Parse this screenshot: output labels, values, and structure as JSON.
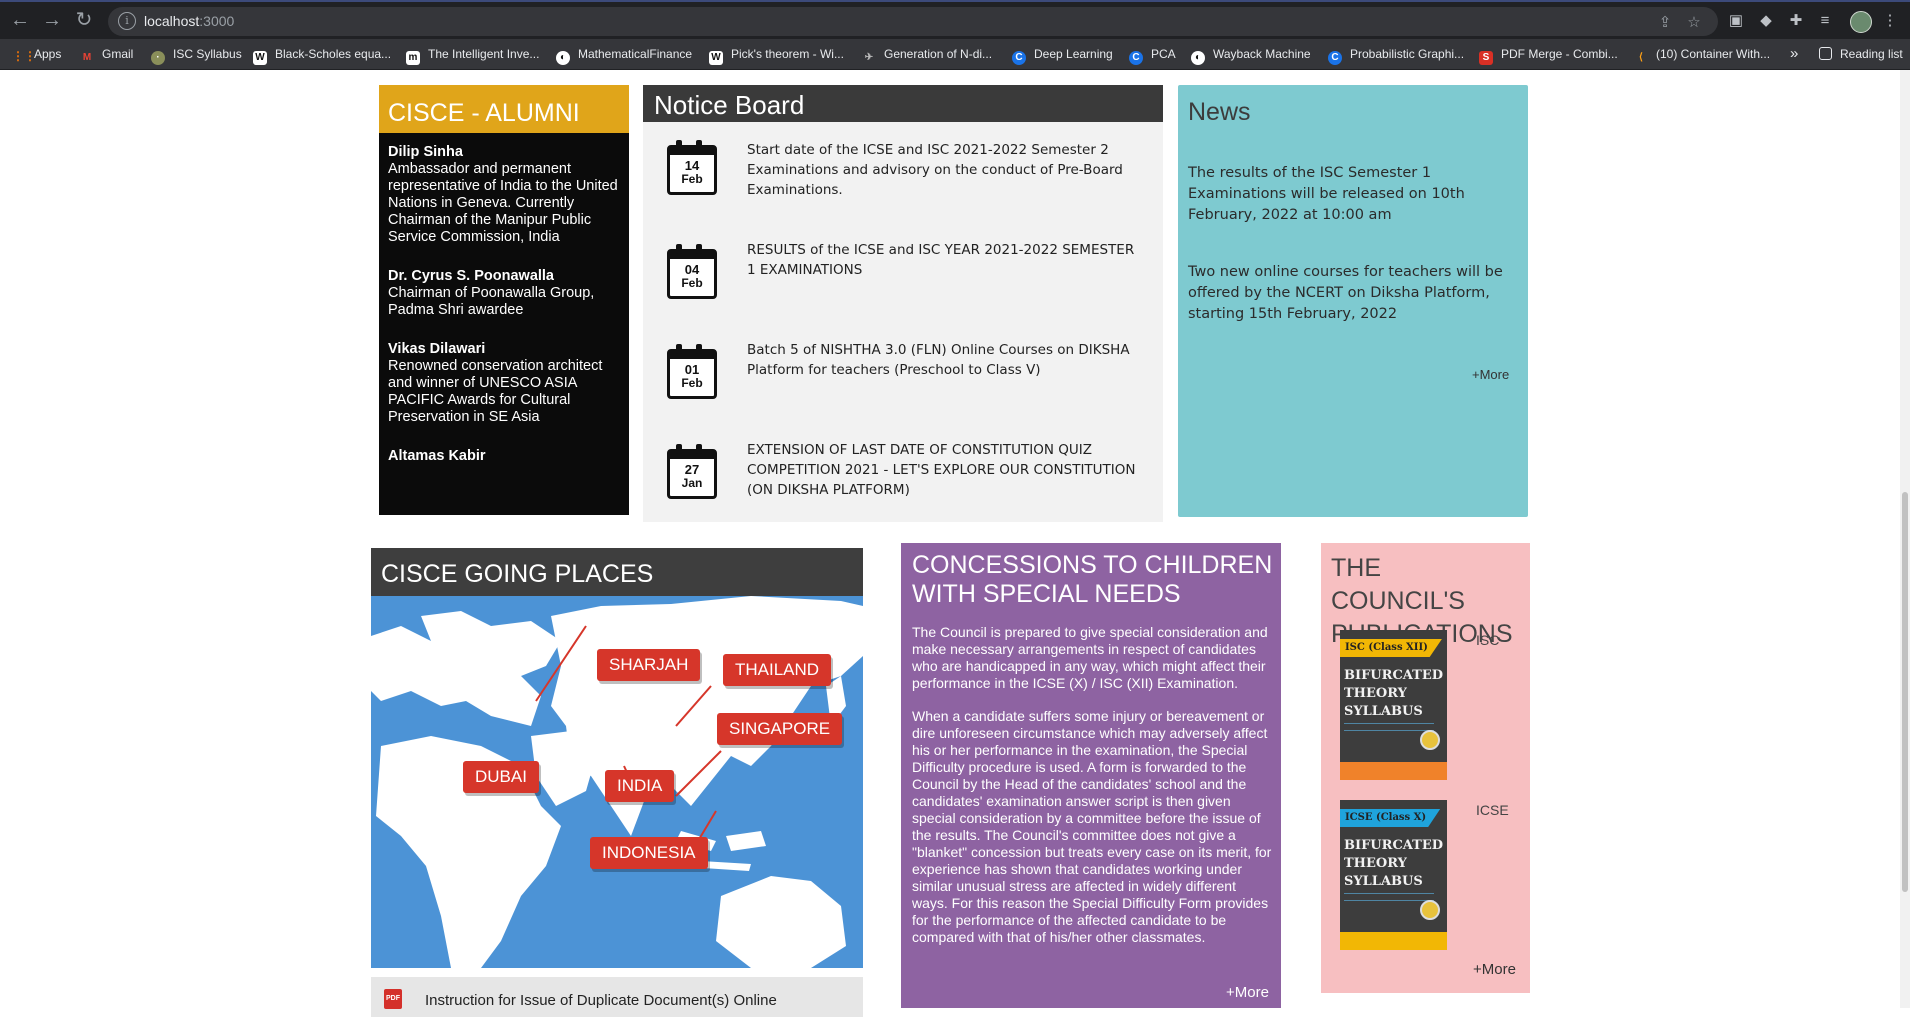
{
  "browser": {
    "url_host": "localhost",
    "url_port": ":3000",
    "bookmarks": [
      {
        "label": "Apps",
        "icon": "apps-grid-icon",
        "color": "#e8710a"
      },
      {
        "label": "Gmail",
        "icon": "gmail-icon",
        "color": "#d93025"
      },
      {
        "label": "ISC Syllabus",
        "icon": "isc-icon",
        "color": "#8a8f5a"
      },
      {
        "label": "Black-Scholes equa...",
        "icon": "wikipedia-icon",
        "color": "#ffffff"
      },
      {
        "label": "The Intelligent Inve...",
        "icon": "m-icon",
        "color": "#ffffff"
      },
      {
        "label": "MathematicalFinance",
        "icon": "globe-icon",
        "color": "#ffffff"
      },
      {
        "label": "Pick's theorem - Wi...",
        "icon": "wikipedia-icon",
        "color": "#ffffff"
      },
      {
        "label": "Generation of N-di...",
        "icon": "bird-icon",
        "color": "#444444"
      },
      {
        "label": "Deep Learning",
        "icon": "c-icon",
        "color": "#1a73e8"
      },
      {
        "label": "PCA",
        "icon": "c-icon",
        "color": "#1a73e8"
      },
      {
        "label": "Wayback Machine",
        "icon": "globe-icon",
        "color": "#ffffff"
      },
      {
        "label": "Probabilistic Graphi...",
        "icon": "c-icon",
        "color": "#1a73e8"
      },
      {
        "label": "PDF Merge - Combi...",
        "icon": "s-icon",
        "color": "#d93025"
      },
      {
        "label": "(10) Container With...",
        "icon": "leetcode-icon",
        "color": "#ffa116"
      }
    ],
    "overflow_label": "»",
    "reading_list_label": "Reading list"
  },
  "alumni": {
    "title": "CISCE - ALUMNI",
    "items": [
      {
        "name": "Dilip Sinha",
        "desc": "Ambassador and permanent representative of India to the United Nations in Geneva. Currently Chairman of the Manipur Public Service Commission, India"
      },
      {
        "name": "Dr. Cyrus S. Poonawalla",
        "desc": "Chairman of Poonawalla Group, Padma Shri awardee"
      },
      {
        "name": "Vikas Dilawari",
        "desc": "Renowned conservation architect and winner of UNESCO ASIA PACIFIC Awards for Cultural Preservation in SE Asia"
      },
      {
        "name": "Altamas Kabir",
        "desc": ""
      }
    ]
  },
  "notice": {
    "title": "Notice Board",
    "items": [
      {
        "day": "14",
        "month": "Feb",
        "text": "Start date of the ICSE and ISC 2021-2022 Semester 2 Examinations and advisory on the conduct of Pre-Board Examinations."
      },
      {
        "day": "04",
        "month": "Feb",
        "text": "RESULTS of the ICSE and ISC YEAR 2021-2022 SEMESTER 1 EXAMINATIONS"
      },
      {
        "day": "01",
        "month": "Feb",
        "text": "Batch 5 of NISHTHA 3.0 (FLN) Online Courses on DIKSHA Platform for teachers (Preschool to Class V)"
      },
      {
        "day": "27",
        "month": "Jan",
        "text": "EXTENSION OF LAST DATE OF CONSTITUTION QUIZ COMPETITION 2021 - LET'S EXPLORE OUR CONSTITUTION (ON DIKSHA PLATFORM)"
      }
    ]
  },
  "news": {
    "title": "News",
    "items": [
      "The results of the ISC Semester 1 Examinations will be released on 10th February, 2022 at 10:00 am",
      "Two new online courses for teachers will be offered by the NCERT on Diksha Platform, starting 15th February, 2022"
    ],
    "more": "+More"
  },
  "places": {
    "title": "CISCE GOING PLACES",
    "cities": [
      "SHARJAH",
      "THAILAND",
      "SINGAPORE",
      "DUBAI",
      "INDIA",
      "INDONESIA"
    ]
  },
  "duplicate_doc": {
    "text": "Instruction for Issue of Duplicate Document(s) Online",
    "icon_label": "PDF"
  },
  "concessions": {
    "title": "CONCESSIONS TO CHILDREN WITH SPECIAL NEEDS",
    "paragraphs": [
      "The Council is prepared to give special consideration and make necessary arrangements in respect of candidates who are handicapped in any way, which might affect their performance in the ICSE (X) / ISC (XII) Examination.",
      "When a candidate suffers some injury or bereavement or dire unforeseen circumstance which may adversely affect his or her performance in the examination, the Special Difficulty procedure is used. A form is forwarded to the Council by the Head of the candidates' school and the candidates' examination answer script is then given special consideration by a committee before the issue of the results. The Council's committee does not give a \"blanket\" concession but treats every case on its merit, for experience has shown that candidates working under similar unusual stress are affected in widely different ways. For this reason the Special Difficulty Form provides for the performance of the affected candidate to be compared with that of his/her other classmates."
    ],
    "more": "+More"
  },
  "publications": {
    "title": "THE COUNCIL'S PUBLICATIONS",
    "books": [
      {
        "label": "ISC",
        "tab": "ISC (Class XII)",
        "tab_color": "#f2b705",
        "footer_color": "#f0822a",
        "cover_lines": [
          "BIFURCATED",
          "THEORY",
          "SYLLABUS"
        ]
      },
      {
        "label": "ICSE",
        "tab": "ICSE (Class X)",
        "tab_color": "#1fa3dc",
        "footer_color": "#f2b705",
        "cover_lines": [
          "BIFURCATED",
          "THEORY",
          "SYLLABUS"
        ]
      }
    ],
    "more": "+More"
  }
}
